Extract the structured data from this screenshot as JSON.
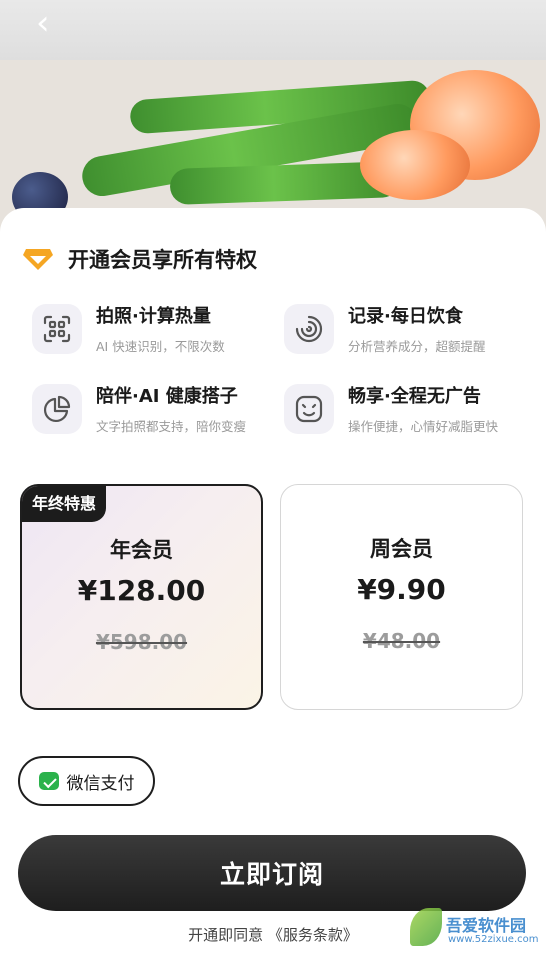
{
  "nav": {
    "back_icon": "chevron-left-icon",
    "back_glyph": "‹"
  },
  "header": {
    "title": "开通会员享所有特权",
    "icon": "diamond-icon",
    "icon_color": "#F5A623"
  },
  "features": [
    {
      "title": "拍照·计算热量",
      "subtitle": "AI 快速识别，不限次数",
      "icon": "scan-icon"
    },
    {
      "title": "记录·每日饮食",
      "subtitle": "分析营养成分，超额提醒",
      "icon": "ring-chart-icon"
    },
    {
      "title": "陪伴·AI 健康搭子",
      "subtitle": "文字拍照都支持，陪你变瘦",
      "icon": "pie-chart-icon"
    },
    {
      "title": "畅享·全程无广告",
      "subtitle": "操作便捷，心情好减脂更快",
      "icon": "smile-icon"
    }
  ],
  "plans": [
    {
      "badge": "年终特惠",
      "name": "年会员",
      "price": "¥128.00",
      "original_price": "¥598.00",
      "selected": true
    },
    {
      "name": "周会员",
      "price": "¥9.90",
      "original_price": "¥48.00",
      "selected": false
    }
  ],
  "payment": {
    "label": "微信支付",
    "icon": "wechat-pay-icon",
    "color": "#2BB24C"
  },
  "subscribe_button": {
    "label": "立即订阅"
  },
  "agreement": {
    "prefix": "开通即同意",
    "terms": "《服务条款》"
  },
  "watermark": {
    "text": "吾爱软件园",
    "url": "www.52zixue.com"
  }
}
